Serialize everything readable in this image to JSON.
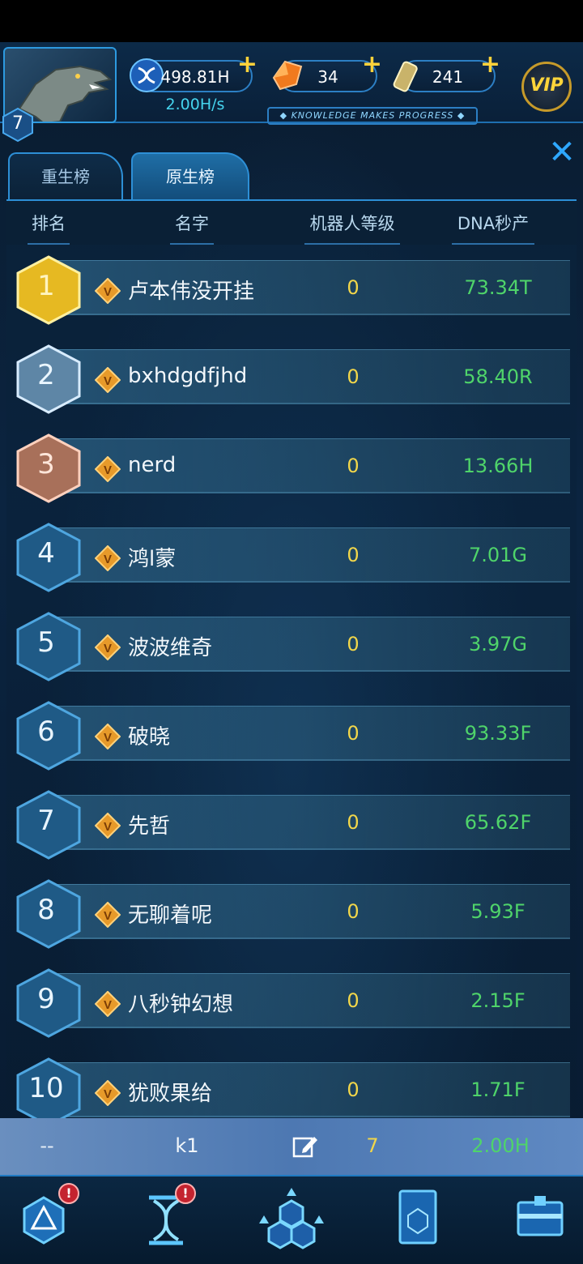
{
  "header": {
    "player_level": "7",
    "dna_value": "498.81H",
    "dna_rate": "2.00H/s",
    "gem_value": "34",
    "canister_value": "241",
    "motto": "◆ KNOWLEDGE MAKES PROGRESS ◆",
    "vip_label": "VIP",
    "plus_symbol": "+"
  },
  "close_label": "✕",
  "tabs": [
    {
      "label": "重生榜",
      "active": false
    },
    {
      "label": "原生榜",
      "active": true
    }
  ],
  "columns": [
    "排名",
    "名字",
    "机器人等级",
    "DNA秒产"
  ],
  "rows": [
    {
      "rank": "1",
      "name": "卢本伟没开挂",
      "level": "0",
      "dna": "73.34T"
    },
    {
      "rank": "2",
      "name": "bxhdgdfjhd",
      "level": "0",
      "dna": "58.40R"
    },
    {
      "rank": "3",
      "name": "nerd",
      "level": "0",
      "dna": "13.66H"
    },
    {
      "rank": "4",
      "name": "鸿l蒙",
      "level": "0",
      "dna": "7.01G"
    },
    {
      "rank": "5",
      "name": "波波维奇",
      "level": "0",
      "dna": "3.97G"
    },
    {
      "rank": "6",
      "name": "破晓",
      "level": "0",
      "dna": "93.33F"
    },
    {
      "rank": "7",
      "name": "先哲",
      "level": "0",
      "dna": "65.62F"
    },
    {
      "rank": "8",
      "name": "无聊着呢",
      "level": "0",
      "dna": "5.93F"
    },
    {
      "rank": "9",
      "name": "八秒钟幻想",
      "level": "0",
      "dna": "2.15F"
    },
    {
      "rank": "10",
      "name": "犹败果给",
      "level": "0",
      "dna": "1.71F"
    }
  ],
  "self_row": {
    "rank": "--",
    "name": "k1",
    "level": "7",
    "dna": "2.00H"
  },
  "nav": {
    "alert_symbol": "!"
  },
  "colors": {
    "gold": "#f1d64a",
    "green": "#4fd46a",
    "accent": "#2d8fd6"
  }
}
